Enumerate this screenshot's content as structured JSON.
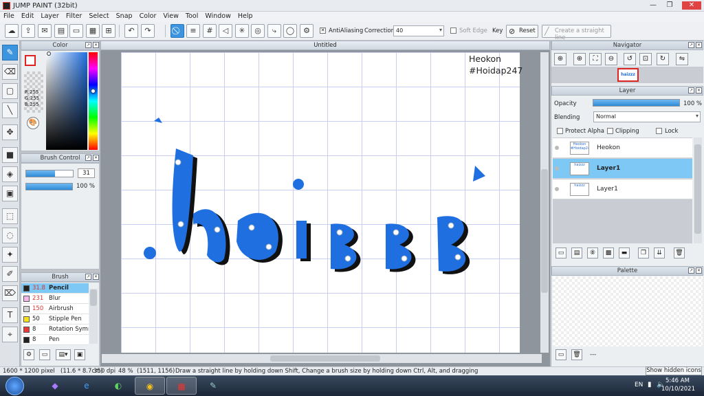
{
  "window": {
    "title": "JUMP PAINT (32bit)"
  },
  "menu": [
    "File",
    "Edit",
    "Layer",
    "Filter",
    "Select",
    "Snap",
    "Color",
    "View",
    "Tool",
    "Window",
    "Help"
  ],
  "toolbar": {
    "antialiasing_label": "AntiAliasing",
    "correction_label": "Correction",
    "correction_value": "40",
    "soft_edge_label": "Soft Edge",
    "key_label": "Key",
    "reset_label": "Reset",
    "straight_line_label": "Create a straight line"
  },
  "color_panel": {
    "title": "Color",
    "r": "R:255",
    "g": "G:255",
    "b": "B:255"
  },
  "brush_control": {
    "title": "Brush Control",
    "size_value": "31",
    "opacity_value": "100 %",
    "size_fraction": 0.62,
    "opacity_fraction": 1.0
  },
  "brush_panel": {
    "title": "Brush",
    "items": [
      {
        "size": "31.8",
        "name": "Pencil",
        "color": "#222222",
        "selected": true
      },
      {
        "size": "231",
        "name": "Blur",
        "color": "#f3b6e8",
        "selected": false
      },
      {
        "size": "150",
        "name": "Airbrush",
        "color": "#cfd3d8",
        "selected": false
      },
      {
        "size": "50",
        "name": "Stipple Pen",
        "color": "#f4e21d",
        "selected": false
      },
      {
        "size": "8",
        "name": "Rotation Symmetry",
        "color": "#e83a3a",
        "selected": false
      },
      {
        "size": "8",
        "name": "Pen",
        "color": "#222222",
        "selected": false
      }
    ]
  },
  "document": {
    "tab_title": "Untitled",
    "canvas_text_line1": "Heokon",
    "canvas_text_line2": "#Hoidap247",
    "artwork_text": "haizzz"
  },
  "navigator": {
    "title": "Navigator",
    "thumb_text": "haizzz"
  },
  "layer_panel": {
    "title": "Layer",
    "opacity_label": "Opacity",
    "opacity_value": "100 %",
    "opacity_fraction": 1.0,
    "blending_label": "Blending",
    "blending_value": "Normal",
    "protect_alpha_label": "Protect Alpha",
    "clipping_label": "Clipping",
    "lock_label": "Lock",
    "layers": [
      {
        "name": "Heokon",
        "thumb": "Heokon #Hoidap247",
        "selected": false,
        "bold": false
      },
      {
        "name": "Layer1",
        "thumb": "haizzz",
        "selected": true,
        "bold": true
      },
      {
        "name": "Layer1",
        "thumb": "haizzz",
        "selected": false,
        "bold": false
      }
    ]
  },
  "palette_panel": {
    "title": "Palette",
    "footer_text": "---"
  },
  "status": {
    "dimensions": "1600 * 1200 pixel",
    "physical": "(11.6 * 8.7cm)",
    "dpi": "350 dpi",
    "zoom": "48 %",
    "cursor": "(1511, 1156)",
    "hint": "Draw a straight line by holding down Shift, Change a brush size by holding down Ctrl, Alt, and dragging",
    "show_hidden_label": "Show hidden icons"
  },
  "taskbar": {
    "language": "EN",
    "time": "5:46 AM",
    "date": "10/10/2021"
  },
  "colors": {
    "accent": "#3d95e0",
    "selection": "#7ec8f5",
    "artwork": "#1f6fe0"
  }
}
